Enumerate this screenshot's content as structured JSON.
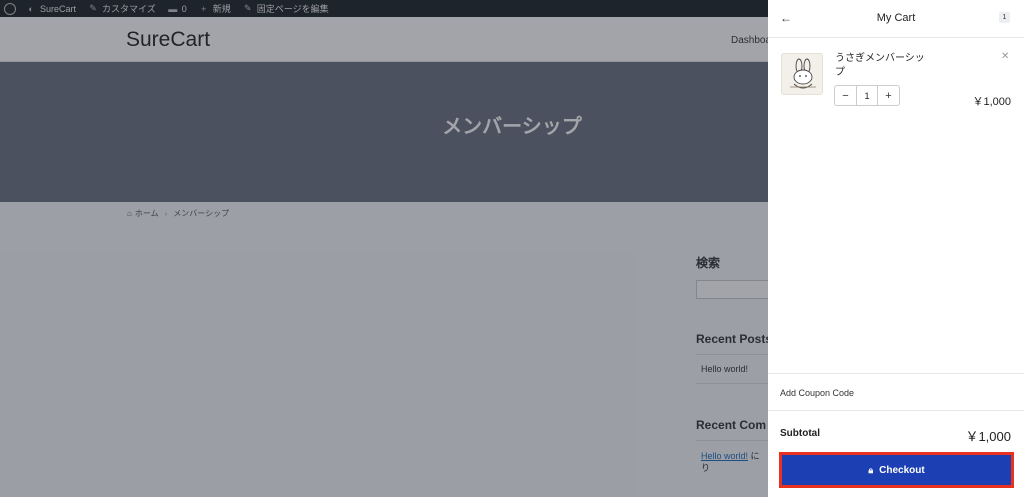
{
  "adminbar": {
    "site_name": "SureCart",
    "customize": "カスタマイズ",
    "comments_count": "0",
    "new_label": "新規",
    "edit_page": "固定ページを編集"
  },
  "header": {
    "site_title": "SureCart",
    "nav_item": "Dashboa"
  },
  "hero": {
    "title": "メンバーシップ"
  },
  "breadcrumb": {
    "home": "ホーム",
    "current": "メンバーシップ"
  },
  "sidebar": {
    "search_heading": "検索",
    "recent_posts_heading": "Recent Posts",
    "recent_posts": [
      "Hello world!"
    ],
    "recent_comments_heading": "Recent Com",
    "comment_link": "Hello world!",
    "comment_suffix": " に",
    "comment_line2": "り"
  },
  "cart": {
    "title": "My Cart",
    "count": "1",
    "item": {
      "name": "うさぎメンバーシップ",
      "quantity": "1",
      "price": "￥1,000",
      "thumb_icon": "rabbit-illustration"
    },
    "coupon_label": "Add Coupon Code",
    "subtotal_label": "Subtotal",
    "subtotal_value": "￥1,000",
    "checkout_label": "Checkout"
  },
  "colors": {
    "checkout_bg": "#1c3fb3",
    "highlight": "#e8321f",
    "adminbar": "#1d2327"
  }
}
